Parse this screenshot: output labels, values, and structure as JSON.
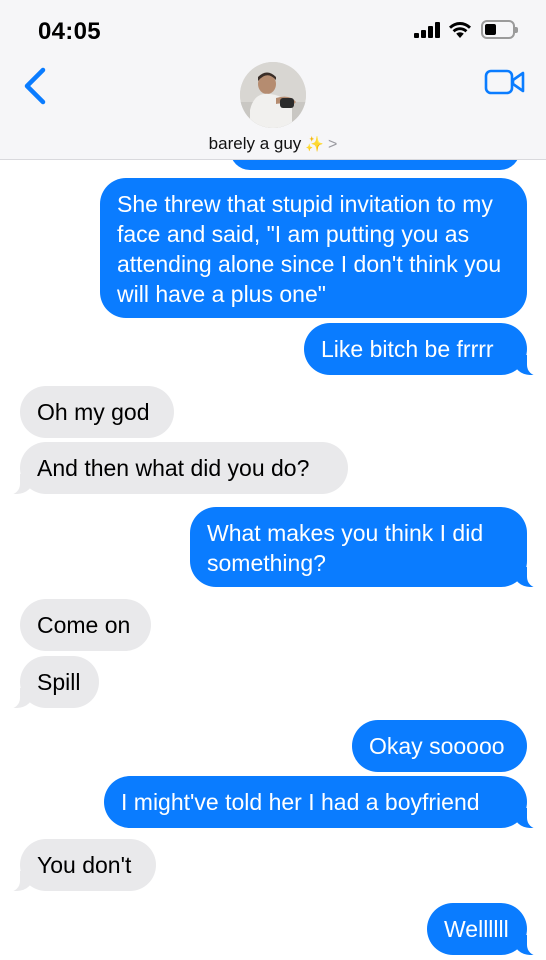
{
  "status_bar": {
    "time": "04:05"
  },
  "header": {
    "contact_name": "barely a guy",
    "sparkle": "✨",
    "chevron": ">"
  },
  "colors": {
    "sent_bubble": "#0a7cff",
    "received_bubble": "#e9e9eb",
    "accent": "#0a7cff"
  },
  "messages": [
    {
      "side": "sent",
      "text": "She threw that stupid invitation to my face and said, \"I am putting you as attending alone since I don't think you will have a plus one\""
    },
    {
      "side": "sent",
      "text": "Like bitch be frrrr"
    },
    {
      "side": "received",
      "text": "Oh my god"
    },
    {
      "side": "received",
      "text": "And then what did you do?"
    },
    {
      "side": "sent",
      "text": "What makes you think I did something?"
    },
    {
      "side": "received",
      "text": "Come on"
    },
    {
      "side": "received",
      "text": "Spill"
    },
    {
      "side": "sent",
      "text": "Okay sooooo"
    },
    {
      "side": "sent",
      "text": "I might've told her I had a boyfriend"
    },
    {
      "side": "received",
      "text": "You don't"
    },
    {
      "side": "sent",
      "text": "Wellllll"
    }
  ]
}
